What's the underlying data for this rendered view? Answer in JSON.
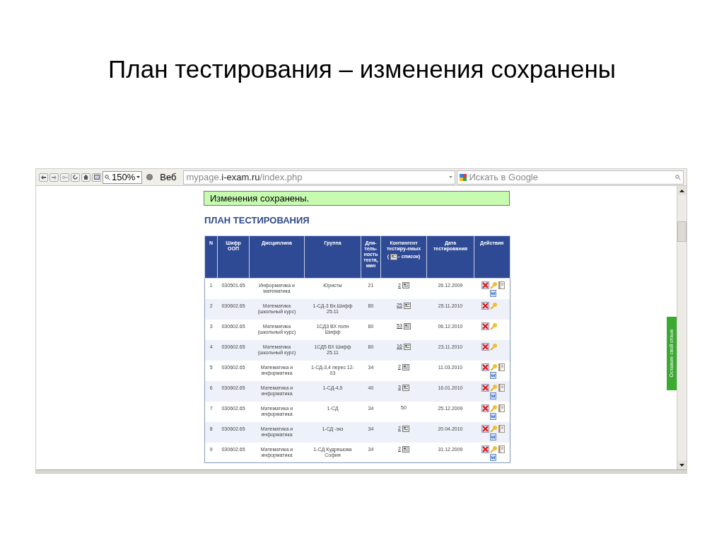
{
  "slide_title": "План тестирования – изменения сохранены",
  "browser": {
    "zoom": "150%",
    "search_mode": "Веб",
    "url": {
      "prefix": "mypage.",
      "host": "i-exam.ru",
      "path": "/index.php"
    },
    "search_placeholder": "Искать в Google"
  },
  "notice": "Изменения сохранены.",
  "heading": "ПЛАН ТЕСТИРОВАНИЯ",
  "table": {
    "columns": [
      "N",
      "Шифр ООП",
      "Дисциплина",
      "Группа",
      "Дли-тель-ность теста, мин",
      {
        "before": "Контингент тестиру-емых",
        "open": "(",
        "after": "– список)"
      },
      "Дата тестирования",
      "Действия"
    ],
    "rows": [
      {
        "n": "1",
        "code": "030501.65",
        "discipline": "Информатика и математика",
        "group": "Юристы",
        "duration": "21",
        "contingent": "2",
        "contingent_link": true,
        "date": "26.12.2009",
        "full_actions": true
      },
      {
        "n": "2",
        "code": "030602.65",
        "discipline": "Математика (школьный курс)",
        "group": "1-СД-3 Вх.Шифф 25.11",
        "duration": "80",
        "contingent": "25",
        "contingent_link": true,
        "date": "25.11.2010",
        "full_actions": false
      },
      {
        "n": "3",
        "code": "030602.65",
        "discipline": "Математика (школьный курс)",
        "group": "1СД3 ВХ попн Шифф",
        "duration": "80",
        "contingent": "53",
        "contingent_link": true,
        "date": "06.12.2010",
        "full_actions": false
      },
      {
        "n": "4",
        "code": "030602.65",
        "discipline": "Математика (школьный курс)",
        "group": "1СД5 ВХ Шифф 25.11",
        "duration": "80",
        "contingent": "16",
        "contingent_link": true,
        "date": "23.11.2010",
        "full_actions": false
      },
      {
        "n": "5",
        "code": "030602.65",
        "discipline": "Математика и информатика",
        "group": "1-СД-3,4 перес 12-03",
        "duration": "34",
        "contingent": "2",
        "contingent_link": true,
        "date": "11.03.2010",
        "full_actions": true
      },
      {
        "n": "6",
        "code": "030602.65",
        "discipline": "Математика и информатика",
        "group": "1-СД-4,5",
        "duration": "40",
        "contingent": "3",
        "contingent_link": true,
        "date": "16.01.2010",
        "full_actions": true
      },
      {
        "n": "7",
        "code": "030602.65",
        "discipline": "Математика и информатика",
        "group": "1-СД",
        "duration": "34",
        "contingent": "50",
        "contingent_link": false,
        "date": "25.12.2009",
        "full_actions": true
      },
      {
        "n": "8",
        "code": "030602.65",
        "discipline": "Математика и информатика",
        "group": "1-СД -экз",
        "duration": "34",
        "contingent": "2",
        "contingent_link": true,
        "date": "20.04.2010",
        "full_actions": true
      },
      {
        "n": "9",
        "code": "030602.65",
        "discipline": "Математика и информатика",
        "group": "1-СД Кудряшова София",
        "duration": "34",
        "contingent": "2",
        "contingent_link": true,
        "date": "31.12.2009",
        "full_actions": true
      }
    ]
  },
  "feedback_tab": "Оставьте свой отзыв"
}
